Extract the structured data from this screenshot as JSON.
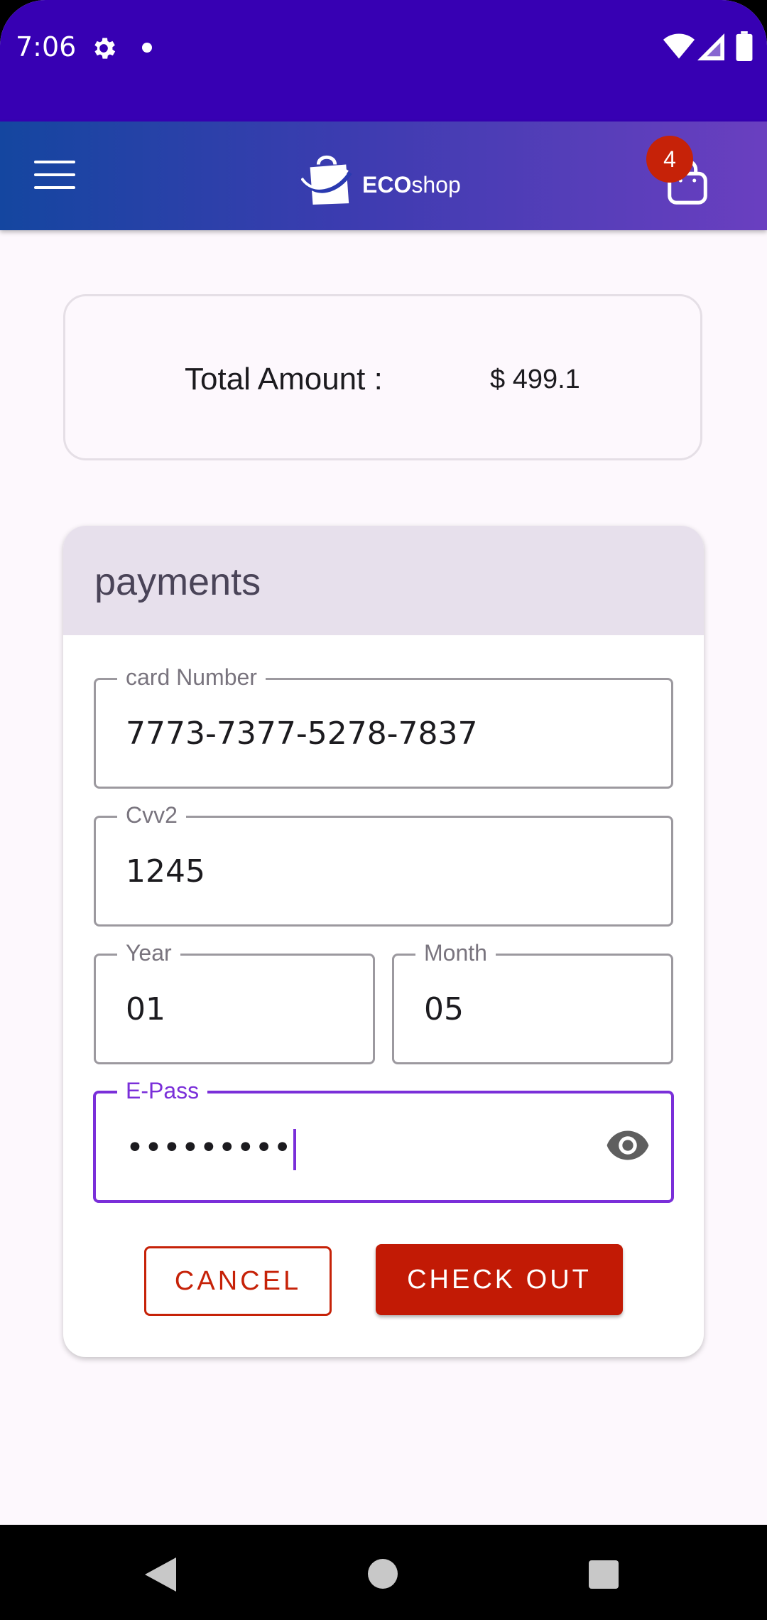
{
  "status_bar": {
    "time": "7:06",
    "icons": [
      "gear-icon",
      "dot-icon",
      "wifi-icon",
      "signal-icon",
      "battery-icon"
    ]
  },
  "app_bar": {
    "brand_bold": "ECO",
    "brand_light": "shop",
    "cart_count": "4",
    "colors": {
      "gradient_start": "#1446a0",
      "gradient_end": "#6a3fc0",
      "badge": "#c62208"
    }
  },
  "total": {
    "label": "Total Amount :",
    "value": "$ 499.1"
  },
  "payments": {
    "title": "payments",
    "card_number": {
      "label": "card Number",
      "value": "7773-7377-5278-7837"
    },
    "cvv2": {
      "label": "Cvv2",
      "value": "1245"
    },
    "year": {
      "label": "Year",
      "value": "01"
    },
    "month": {
      "label": "Month",
      "value": "05"
    },
    "epass": {
      "label": "E-Pass",
      "value": "•••••••••"
    },
    "cancel_label": "CANCEL",
    "checkout_label": "CHECK OUT",
    "colors": {
      "accent": "#7a2fd9",
      "primary_button": "#c21a05"
    }
  }
}
